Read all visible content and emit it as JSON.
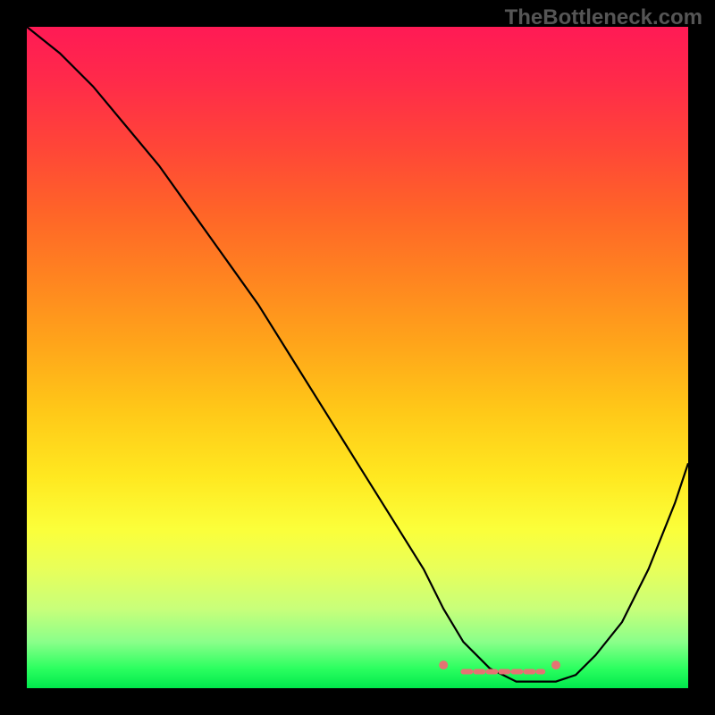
{
  "watermark": "TheBottleneck.com",
  "chart_data": {
    "type": "line",
    "title": "",
    "xlabel": "",
    "ylabel": "",
    "xlim": [
      0,
      100
    ],
    "ylim": [
      0,
      100
    ],
    "series": [
      {
        "name": "bottleneck-curve",
        "x": [
          0,
          5,
          10,
          15,
          20,
          25,
          30,
          35,
          40,
          45,
          50,
          55,
          60,
          63,
          66,
          70,
          74,
          78,
          80,
          83,
          86,
          90,
          94,
          98,
          100
        ],
        "values": [
          100,
          96,
          91,
          85,
          79,
          72,
          65,
          58,
          50,
          42,
          34,
          26,
          18,
          12,
          7,
          3,
          1,
          1,
          1,
          2,
          5,
          10,
          18,
          28,
          34
        ]
      }
    ],
    "annotations": [
      {
        "name": "valley-marker-left",
        "x": 63,
        "y": 3.5,
        "color": "#e57373"
      },
      {
        "name": "valley-marker-right",
        "x": 80,
        "y": 3.5,
        "color": "#e57373"
      },
      {
        "name": "valley-band",
        "x_start": 66,
        "x_end": 78,
        "y": 2.5,
        "color": "#e57373"
      }
    ]
  }
}
